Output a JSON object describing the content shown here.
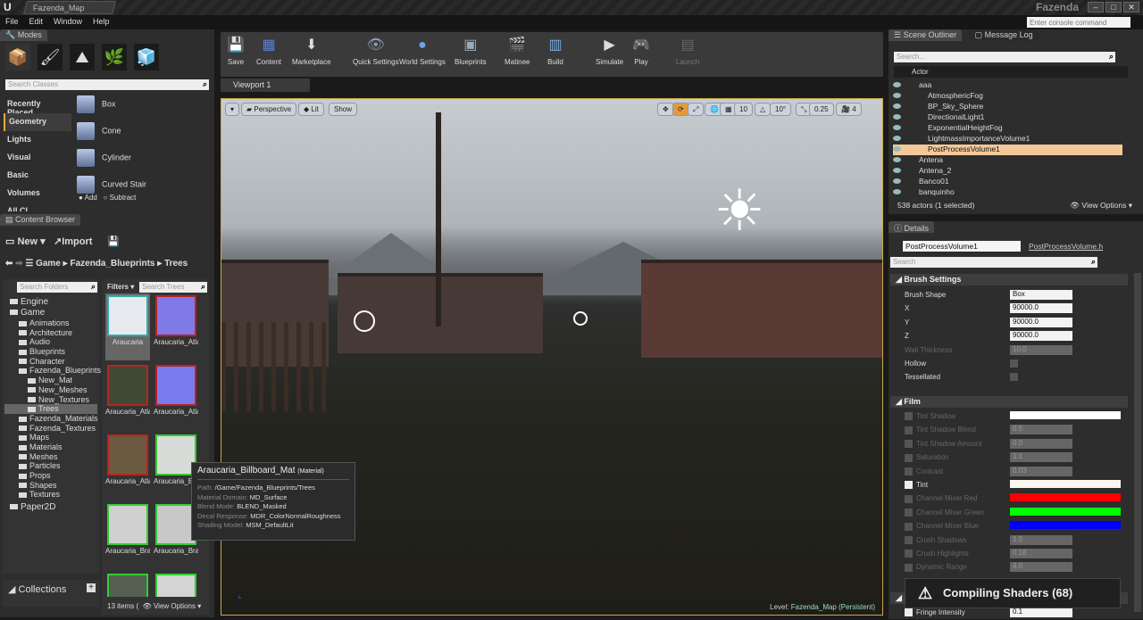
{
  "window": {
    "tab": "Fazenda_Map",
    "app_name": "Fazenda",
    "console_placeholder": "Enter console command"
  },
  "menu": [
    "File",
    "Edit",
    "Window",
    "Help"
  ],
  "modes": {
    "tab": "Modes",
    "search_placeholder": "Search Classes",
    "categories": [
      "Recently Placed",
      "Geometry",
      "Lights",
      "Visual",
      "Basic",
      "Volumes",
      "All Cl"
    ],
    "selected_category": "Geometry",
    "items": [
      "Box",
      "Cone",
      "Cylinder",
      "Curved Stair"
    ],
    "add": "Add",
    "subtract": "Subtract"
  },
  "content_browser": {
    "tab": "Content Browser",
    "new": "New",
    "import": "Import",
    "path": [
      "Game",
      "Fazenda_Blueprints",
      "Trees"
    ],
    "folder_search": "Search Folders",
    "filters": "Filters",
    "asset_search": "Search Trees",
    "folders": [
      {
        "n": "Engine",
        "d": 0
      },
      {
        "n": "Game",
        "d": 0
      },
      {
        "n": "Animations",
        "d": 1
      },
      {
        "n": "Architecture",
        "d": 1
      },
      {
        "n": "Audio",
        "d": 1
      },
      {
        "n": "Blueprints",
        "d": 1
      },
      {
        "n": "Character",
        "d": 1
      },
      {
        "n": "Fazenda_Blueprints",
        "d": 1
      },
      {
        "n": "New_Mat",
        "d": 2
      },
      {
        "n": "New_Meshes",
        "d": 2
      },
      {
        "n": "New_Textures",
        "d": 2
      },
      {
        "n": "Trees",
        "d": 2,
        "sel": true
      },
      {
        "n": "Fazenda_Materials",
        "d": 1
      },
      {
        "n": "Fazenda_Textures",
        "d": 1
      },
      {
        "n": "Maps",
        "d": 1
      },
      {
        "n": "Materials",
        "d": 1
      },
      {
        "n": "Meshes",
        "d": 1
      },
      {
        "n": "Particles",
        "d": 1
      },
      {
        "n": "Props",
        "d": 1
      },
      {
        "n": "Shapes",
        "d": 1
      },
      {
        "n": "Textures",
        "d": 1
      },
      {
        "n": "Paper2D",
        "d": 0
      }
    ],
    "assets": [
      {
        "n": "Araucaria",
        "c": "#e6eaee",
        "b": "#3aa"
      },
      {
        "n": "Araucaria_Atlas_Billboar",
        "c": "#7f7ae8",
        "b": "#b22"
      },
      {
        "n": "Araucaria_Atlas_Billboar",
        "c": "#3f4a35",
        "b": "#b22"
      },
      {
        "n": "Araucaria_Atlas_Normal",
        "c": "#7b7bf0",
        "b": "#b22"
      },
      {
        "n": "Araucaria_Atlas_Tex",
        "c": "#6b5a40",
        "b": "#b22"
      },
      {
        "n": "Araucaria_Billboard_M",
        "c": "#d8dcd8",
        "b": "#3c3"
      },
      {
        "n": "Araucaria_Branches_2_",
        "c": "#d0d0d0",
        "b": "#3c3"
      },
      {
        "n": "Araucaria_Branches_M",
        "c": "#c8c8c8",
        "b": "#3c3"
      },
      {
        "n": "",
        "c": "#556050",
        "b": "#3c3"
      },
      {
        "n": "",
        "c": "#d4d4d4",
        "b": "#3c3"
      }
    ],
    "status": "13 items (",
    "view_options": "View Options",
    "collections": "Collections"
  },
  "tooltip": {
    "title": "Araucaria_Billboard_Mat",
    "type": "(Material)",
    "rows": [
      [
        "Path:",
        "/Game/Fazenda_Blueprints/Trees"
      ],
      [
        "Material Domain:",
        "MD_Surface"
      ],
      [
        "Blend Mode:",
        "BLEND_Masked"
      ],
      [
        "Decal Response:",
        "MDR_ColorNormalRoughness"
      ],
      [
        "Shading Model:",
        "MSM_DefaultLit"
      ]
    ]
  },
  "toolbar": [
    {
      "l": "Save",
      "i": "💾"
    },
    {
      "l": "Content",
      "i": "▦"
    },
    {
      "l": "Marketplace",
      "i": "⬇"
    },
    {
      "l": "Quick Settings",
      "i": "👁"
    },
    {
      "l": "World Settings",
      "i": "●"
    },
    {
      "l": "Blueprints",
      "i": "▣"
    },
    {
      "l": "Matinee",
      "i": "🎬"
    },
    {
      "l": "Build",
      "i": "▥"
    },
    {
      "l": "Simulate",
      "i": "▶"
    },
    {
      "l": "Play",
      "i": "🎮"
    },
    {
      "l": "Launch",
      "i": "▤"
    }
  ],
  "viewport": {
    "tab": "Viewport 1",
    "perspective": "Perspective",
    "lit": "Lit",
    "show": "Show",
    "grid_snap": "10",
    "rotation_snap": "10°",
    "scale_snap": "0.25",
    "camera_speed": "4",
    "level_label": "Level:",
    "level": "Fazenda_Map (Persistent)"
  },
  "outliner": {
    "tab": "Scene Outliner",
    "tab2": "Message Log",
    "search_placeholder": "Search...",
    "column": "Actor",
    "items": [
      {
        "n": "aaa",
        "d": 0
      },
      {
        "n": "AtmosphericFog",
        "d": 1
      },
      {
        "n": "BP_Sky_Sphere",
        "d": 1
      },
      {
        "n": "DirectionalLight1",
        "d": 1
      },
      {
        "n": "ExponentialHeightFog",
        "d": 1
      },
      {
        "n": "LightmassImportanceVolume1",
        "d": 1
      },
      {
        "n": "PostProcessVolume1",
        "d": 1,
        "sel": true
      },
      {
        "n": "Antena",
        "d": 0
      },
      {
        "n": "Antena_2",
        "d": 0
      },
      {
        "n": "Banco01",
        "d": 0
      },
      {
        "n": "banquinho",
        "d": 0
      }
    ],
    "status": "538 actors (1 selected)",
    "view_options": "View Options"
  },
  "details": {
    "tab": "Details",
    "name": "PostProcessVolume1",
    "source": "PostProcessVolume.h",
    "search_placeholder": "Search",
    "brush": {
      "title": "Brush Settings",
      "rows": [
        {
          "l": "Brush Shape",
          "v": "Box"
        },
        {
          "l": "X",
          "v": "90000.0"
        },
        {
          "l": "Y",
          "v": "90000.0"
        },
        {
          "l": "Z",
          "v": "90000.0"
        },
        {
          "l": "Wall Thickness",
          "v": "10.0",
          "dim": true
        },
        {
          "l": "Hollow",
          "cb": true
        },
        {
          "l": "Tessellated",
          "cb": true
        }
      ]
    },
    "film": {
      "title": "Film",
      "rows": [
        {
          "l": "Tint Shadow",
          "sw": "#ffffff",
          "dim": true
        },
        {
          "l": "Tint Shadow Blend",
          "v": "0.5",
          "dim": true
        },
        {
          "l": "Tint Shadow Amount",
          "v": "0.0",
          "dim": true
        },
        {
          "l": "Saturation",
          "v": "1.1",
          "dim": true
        },
        {
          "l": "Contrast",
          "v": "0.03",
          "dim": true
        },
        {
          "l": "Tint",
          "sw": "#fcf6f0",
          "checked": true
        },
        {
          "l": "Channel Mixer Red",
          "sw": "#ff0000",
          "dim": true
        },
        {
          "l": "Channel Mixer Green",
          "sw": "#00ff00",
          "dim": true
        },
        {
          "l": "Channel Mixer Blue",
          "sw": "#0000ff",
          "dim": true
        },
        {
          "l": "Crush Shadows",
          "v": "1.0",
          "dim": true
        },
        {
          "l": "Crush Highlights",
          "v": "0.18",
          "dim": true
        },
        {
          "l": "Dynamic Range",
          "v": "4.0",
          "dim": true
        }
      ]
    },
    "next_section": "S",
    "fringe": {
      "l": "Fringe Intensity",
      "v": "0.1"
    }
  },
  "notification": {
    "text": "Compiling Shaders (68)"
  }
}
